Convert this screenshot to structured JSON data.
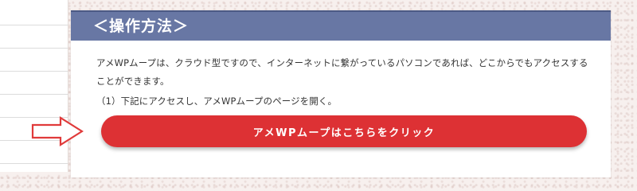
{
  "section": {
    "title": "＜操作方法＞",
    "description": "アメWPムープは、クラウド型ですので、インターネットに繋がっているパソコンであれば、どこからでもアクセスすることができます。",
    "step1": "（1）下記にアクセスし、アメWPムープのページを開く。",
    "cta_label": "アメWPムープはこちらをクリック"
  },
  "colors": {
    "header_bg": "#6877a4",
    "cta_bg": "#dd3134",
    "arrow_stroke": "#e03a3a"
  },
  "icons": {
    "pointer_arrow": "right-arrow-icon"
  }
}
